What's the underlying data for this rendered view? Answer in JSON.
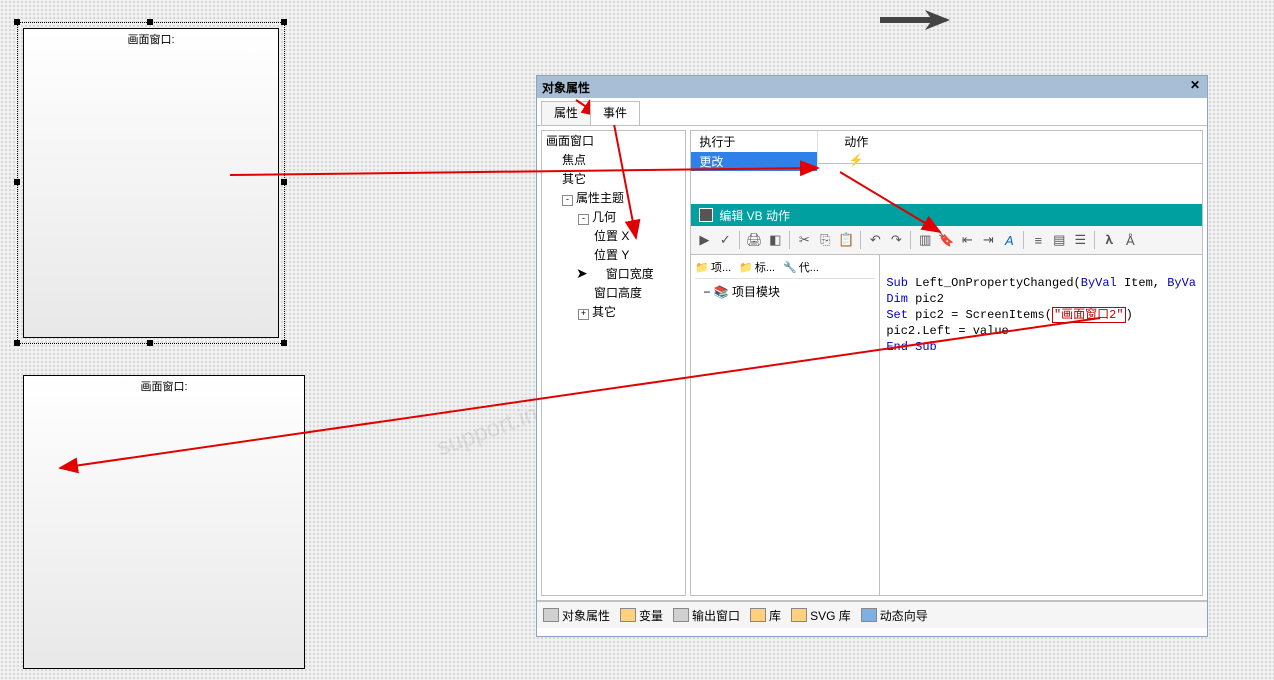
{
  "box1": {
    "title": "画面窗口:"
  },
  "box2": {
    "title": "画面窗口:"
  },
  "panel": {
    "title": "对象属性",
    "close": "✕",
    "tabs": {
      "t0": "属性",
      "t1": "事件"
    }
  },
  "tree": {
    "root": "画面窗口",
    "n_focus": "焦点",
    "n_other": "其它",
    "n_prop_subj": "属性主题",
    "n_geom": "几何",
    "n_posx": "位置 X",
    "n_posy": "位置 Y",
    "n_winw": "窗口宽度",
    "n_winh": "窗口高度",
    "n_other2": "其它",
    "tog_minus": "-",
    "tog_plus": "+"
  },
  "events": {
    "col1": "执行于",
    "col2": "动作",
    "row1_col1": "更改",
    "row1_col2": "⚡"
  },
  "vb": {
    "title": "编辑 VB 动作",
    "left_tab1": "项...",
    "left_tab2": "标...",
    "left_tab3": "代...",
    "project_modules": "项目模块",
    "minus": "−"
  },
  "code": {
    "l1a": "Sub",
    "l1b": " Left_OnPropertyChanged(",
    "l1c": "ByVal",
    "l1d": " Item, ",
    "l1e": "ByVa",
    "l2a": "Dim",
    "l2b": " pic2",
    "l3a": "Set",
    "l3b": " pic2 = ScreenItems(",
    "l3c": "\"画面窗口2\"",
    "l3d": ")",
    "l4": "pic2.Left = value",
    "l5": "End Sub"
  },
  "status": {
    "s1": "对象属性",
    "s2": "变量",
    "s3": "输出窗口",
    "s4": "库",
    "s5": "SVG 库",
    "s6": "动态向导"
  },
  "watermark": "support.industry.siemens"
}
